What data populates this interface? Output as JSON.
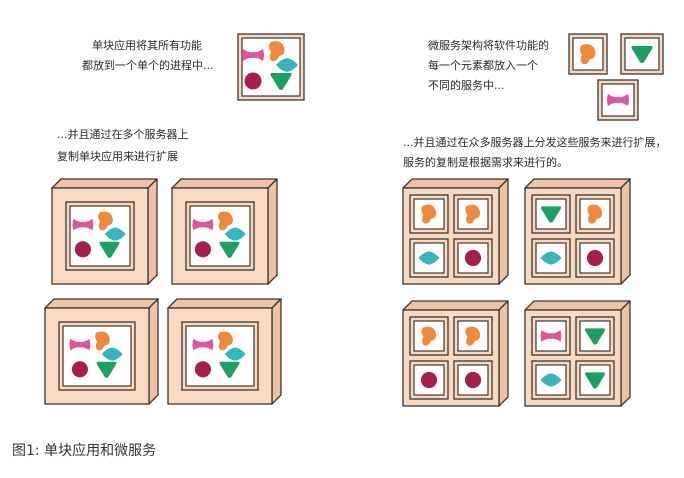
{
  "monolith": {
    "intro_line1": "单块应用将其所有功能",
    "intro_line2": "都放到一个单个的进程中...",
    "scale_line1": "...并且通过在多个服务器上",
    "scale_line2": "复制单块应用来进行扩展"
  },
  "microservices": {
    "intro_line1": "微服务架构将软件功能的",
    "intro_line2": "每一个元素都放入一个",
    "intro_line3": "不同的服务中...",
    "scale_line1": "...并且通过在众多服务器上分发这些服务来进行扩展，",
    "scale_line2": "服务的复制是根据需求来进行的。"
  },
  "caption": "图1: 单块应用和微服务",
  "colors": {
    "box_fill": "#f7d9c4",
    "box_side": "#ecc3a8",
    "outline": "#3d3530",
    "panel": "#ffffff",
    "pink": "#e0559a",
    "orange": "#ee8a3c",
    "teal": "#37b5bd",
    "maroon": "#a51e4f",
    "green": "#1f9e63"
  },
  "icons": [
    "bowtie-shape-icon",
    "blob-shape-icon",
    "diamond-shape-icon",
    "circle-shape-icon",
    "triangle-shape-icon"
  ]
}
